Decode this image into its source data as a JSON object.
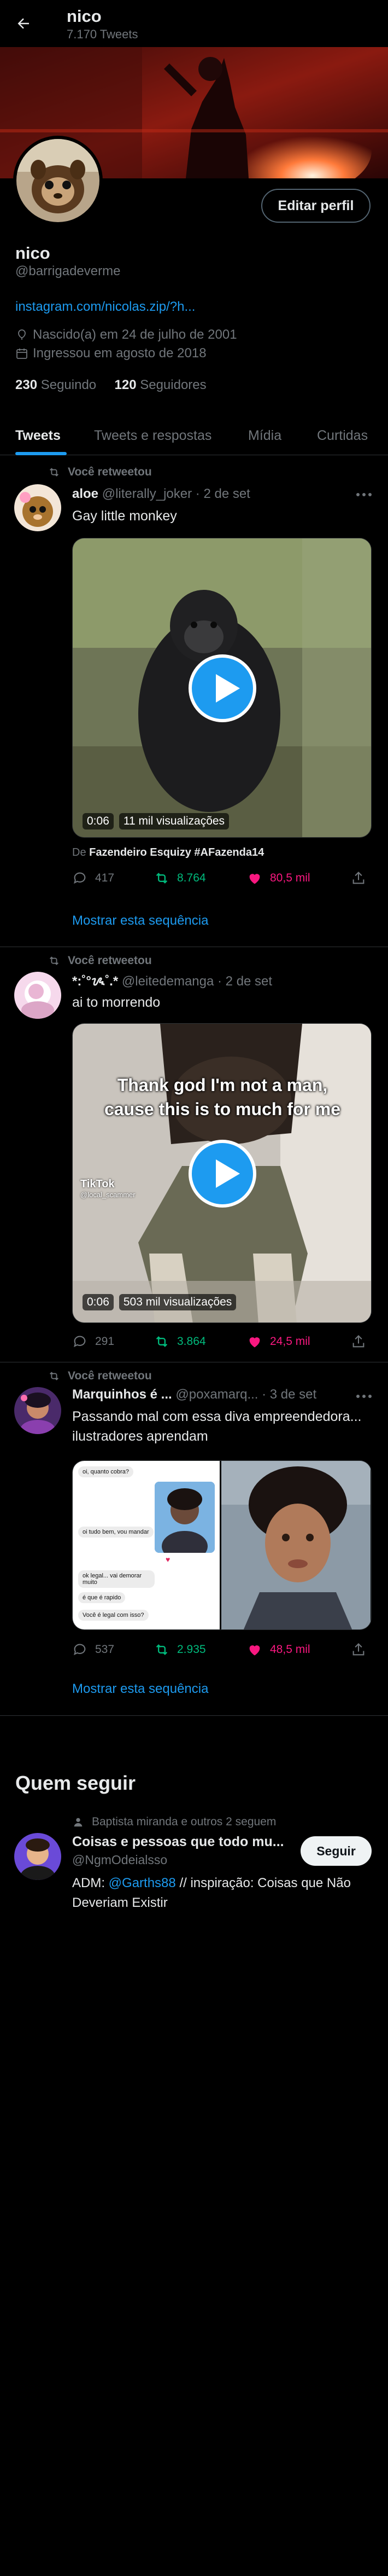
{
  "top_bar": {
    "name": "nico",
    "tweet_count": "7.170 Tweets"
  },
  "profile": {
    "name": "nico",
    "handle": "@barrigadeverme",
    "link": "instagram.com/nicolas.zip/?h...",
    "birth": "Nascido(a) em 24 de julho de 2001",
    "joined": "Ingressou em agosto de 2018",
    "following_count": "230",
    "following_label": "Seguindo",
    "followers_count": "120",
    "followers_label": "Seguidores",
    "edit_button": "Editar perfil"
  },
  "tabs": [
    "Tweets",
    "Tweets e respostas",
    "Mídia",
    "Curtidas"
  ],
  "tweets": [
    {
      "retweet_label": "Você retweetou",
      "name": "aloe",
      "handle": "@literally_joker",
      "date": "· 2 de set",
      "text": "Gay little monkey",
      "video_time": "0:06",
      "video_views": "11 mil visualizações",
      "from_prefix": "De",
      "from_source": "Fazendeiro Esquizy #AFazenda14",
      "replies": "417",
      "retweets": "8.764",
      "likes": "80,5 mil",
      "show_thread": "Mostrar esta sequência"
    },
    {
      "retweet_label": "Você retweetou",
      "name": "*:˚°ᝰ˚.*",
      "handle": "@leitedemanga",
      "date": "· 2 de set",
      "text": "ai to morrendo",
      "video_caption": "Thank god I'm not a man, cause this is to much for me",
      "tiktok_label": "TikTok",
      "tiktok_user": "@local_scammer",
      "video_time": "0:06",
      "video_views": "503 mil visualizações",
      "replies": "291",
      "retweets": "3.864",
      "likes": "24,5 mil"
    },
    {
      "retweet_label": "Você retweetou",
      "name": "Marquinhos é ...",
      "handle": "@poxamarq...",
      "date": "· 3 de set",
      "text": "Passando mal com essa diva empreendedora... ilustradores aprendam",
      "chat_lines": [
        "oi, quanto cobra?",
        "oi tudo bem, vou mandar",
        "ok legal... vai demorar muito",
        "é que é rapido",
        "Você é legal com isso?"
      ],
      "replies": "537",
      "retweets": "2.935",
      "likes": "48,5 mil",
      "show_thread": "Mostrar esta sequência"
    }
  ],
  "who_to_follow": {
    "title": "Quem seguir",
    "note": "Baptista miranda e outros 2 seguem",
    "name": "Coisas e pessoas que todo mu...",
    "handle": "@NgmOdeialsso",
    "bio_prefix": "ADM:",
    "bio_mention": "@Garths88",
    "bio_rest": "// inspiração: Coisas que Não Deveriam Existir",
    "follow_button": "Seguir"
  },
  "colors": {
    "accent": "#1d9bf0",
    "retweet": "#00ba7c",
    "like": "#f91880",
    "muted": "#71767b"
  }
}
